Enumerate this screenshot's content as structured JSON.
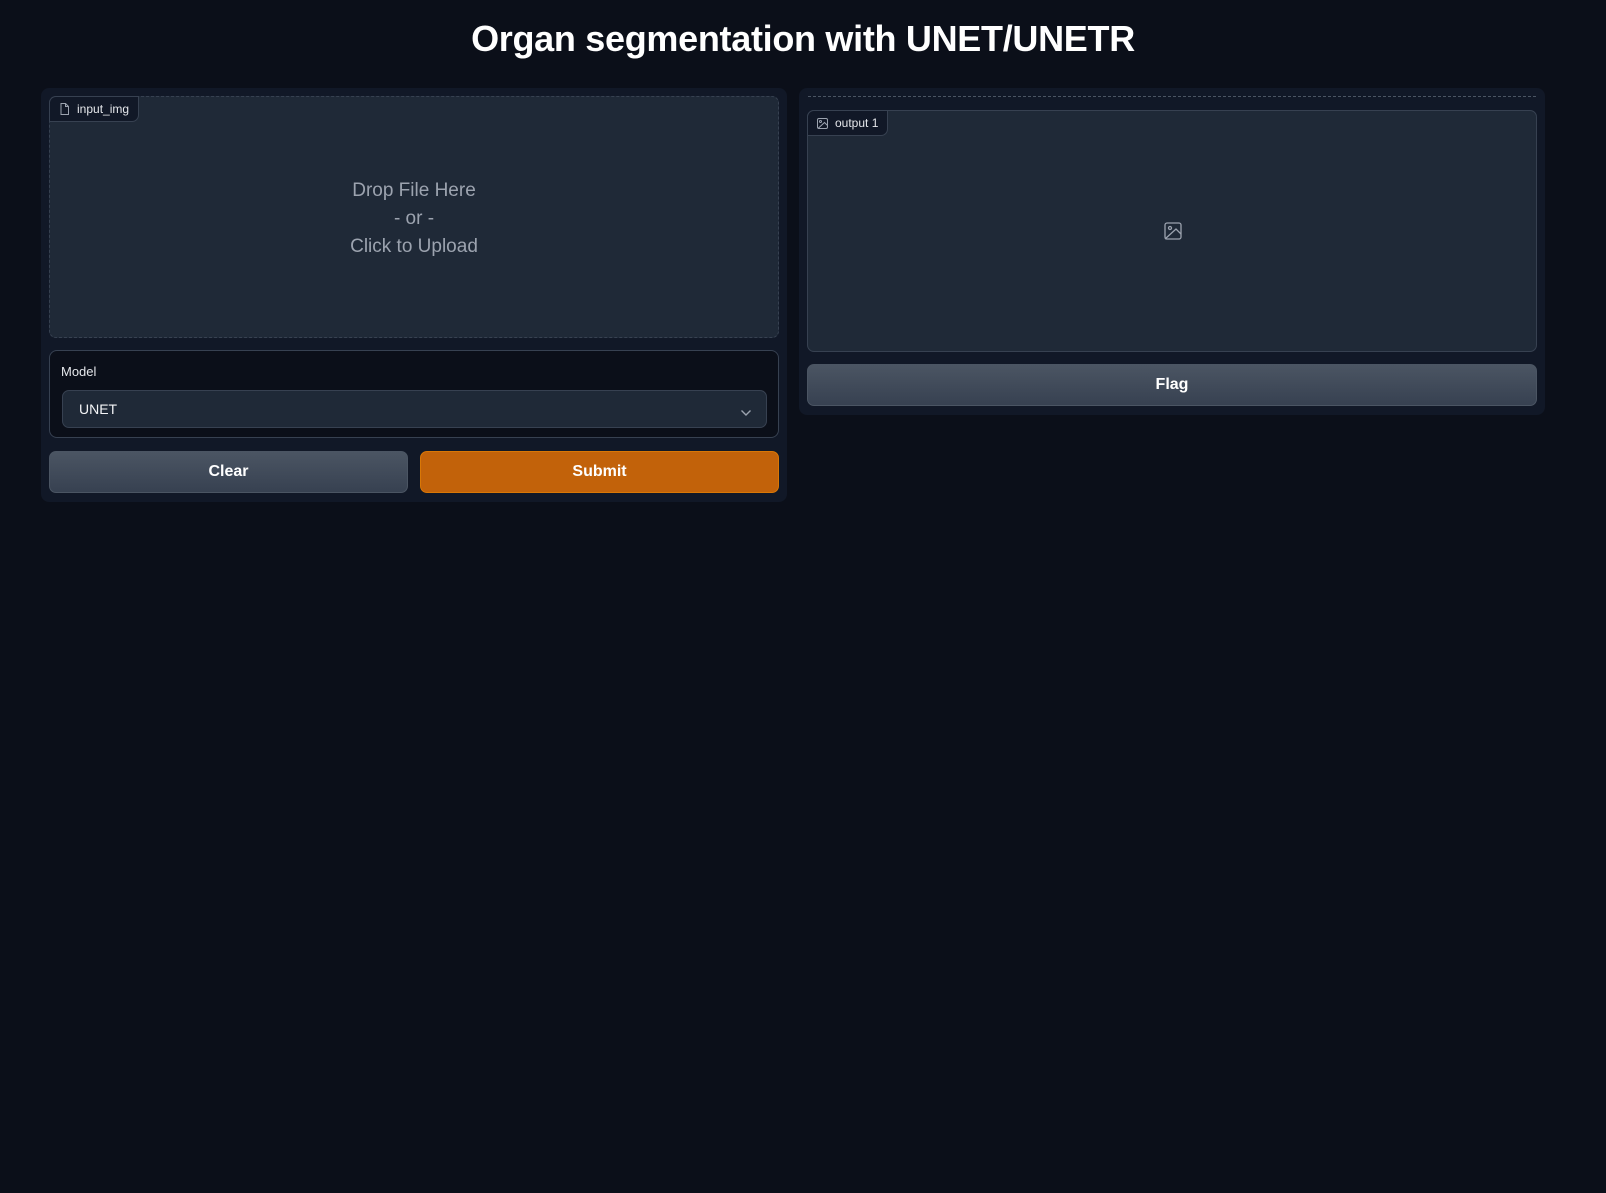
{
  "page": {
    "title": "Organ segmentation with UNET/UNETR"
  },
  "input": {
    "label": "input_img",
    "label_icon": "file-icon",
    "drop_line1": "Drop File Here",
    "drop_line2": "- or -",
    "drop_line3": "Click to Upload"
  },
  "model": {
    "label": "Model",
    "selected": "UNET",
    "icon": "chevron-down-icon"
  },
  "actions": {
    "clear_label": "Clear",
    "submit_label": "Submit"
  },
  "output": {
    "label": "output 1",
    "label_icon": "image-icon",
    "placeholder_icon": "image-icon",
    "flag_label": "Flag"
  },
  "colors": {
    "background": "#0b0f19",
    "panel": "#111827",
    "surface": "#1f2937",
    "border": "#374151",
    "primary": "#c2620a"
  }
}
